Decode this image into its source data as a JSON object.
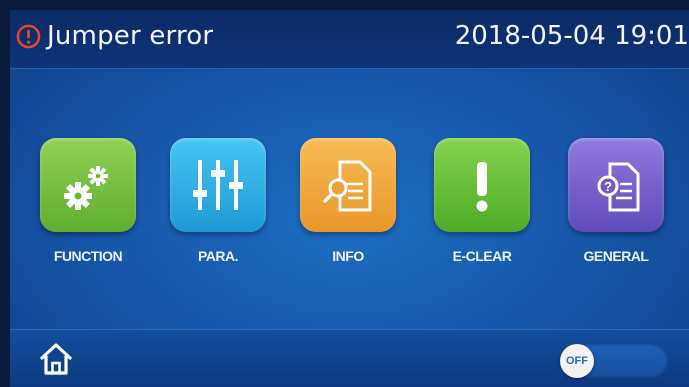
{
  "header": {
    "alert_icon": "error-exclamation-icon",
    "alert_color": "#e8472b",
    "alert_text": "Jumper error",
    "datetime": "2018-05-04 19:01"
  },
  "menu": {
    "items": [
      {
        "label": "FUNCTION",
        "icon": "gears-icon",
        "color": "#7cc243"
      },
      {
        "label": "PARA.",
        "icon": "sliders-icon",
        "color": "#2eb4e6"
      },
      {
        "label": "INFO",
        "icon": "document-search-icon",
        "color": "#f0a63a"
      },
      {
        "label": "E-CLEAR",
        "icon": "exclamation-icon",
        "color": "#6cc236"
      },
      {
        "label": "GENERAL",
        "icon": "document-help-icon",
        "color": "#7a64cc"
      }
    ]
  },
  "footer": {
    "home_icon": "home-icon",
    "toggle_label": "OFF"
  }
}
